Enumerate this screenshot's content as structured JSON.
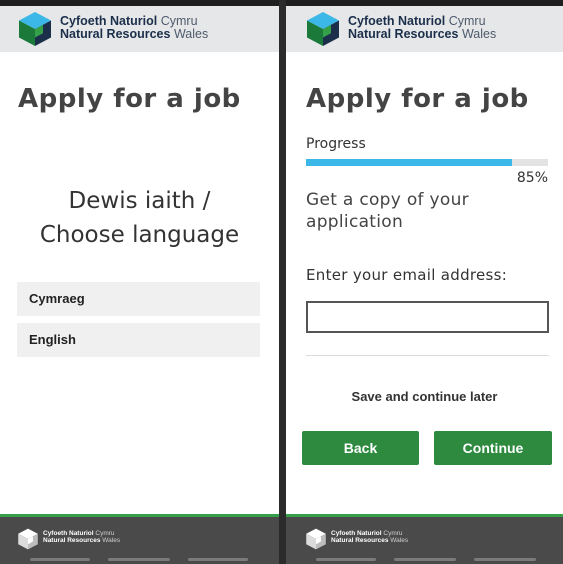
{
  "brand": {
    "welsh_bold": "Cyfoeth Naturiol",
    "welsh_light": "Cymru",
    "english_bold": "Natural Resources",
    "english_light": "Wales"
  },
  "left_screen": {
    "page_title": "Apply for a job",
    "language_heading_line1": "Dewis iaith /",
    "language_heading_line2": "Choose language",
    "languages": [
      "Cymraeg",
      "English"
    ]
  },
  "right_screen": {
    "page_title": "Apply for a job",
    "progress_label": "Progress",
    "progress_value": 0.85,
    "progress_text": "85%",
    "subtitle": "Get a copy of your application",
    "email_label": "Enter your email address:",
    "email_value": "",
    "save_later_label": "Save and continue later",
    "back_label": "Back",
    "continue_label": "Continue"
  },
  "colors": {
    "header_bg": "#e6e7e8",
    "button_green": "#2d8a3e",
    "progress_blue": "#3bb8e8",
    "footer_bg": "#4a4a4a",
    "footer_accent": "#35a04a"
  },
  "icons": {
    "logo": "nrw-cube-logo-icon"
  }
}
